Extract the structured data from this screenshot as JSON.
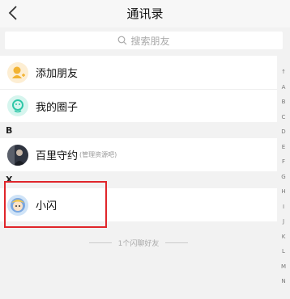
{
  "header": {
    "title": "通讯录"
  },
  "search": {
    "placeholder": "搜索朋友"
  },
  "top_items": [
    {
      "label": "添加朋友"
    },
    {
      "label": "我的圈子"
    }
  ],
  "sections": [
    {
      "letter": "B",
      "contacts": [
        {
          "name": "百里守约",
          "sub": "(管理资源吧)"
        }
      ]
    },
    {
      "letter": "X",
      "contacts": [
        {
          "name": "小闪"
        }
      ]
    }
  ],
  "footer": {
    "text": "1个闪聊好友"
  },
  "index_letters": [
    "↑",
    "A",
    "B",
    "C",
    "D",
    "E",
    "F",
    "G",
    "H",
    "I",
    "J",
    "K",
    "L",
    "M",
    "N"
  ],
  "colors": {
    "highlight": "#e0262b",
    "add_friend": "#f2b333",
    "circle": "#2ec7a8"
  }
}
